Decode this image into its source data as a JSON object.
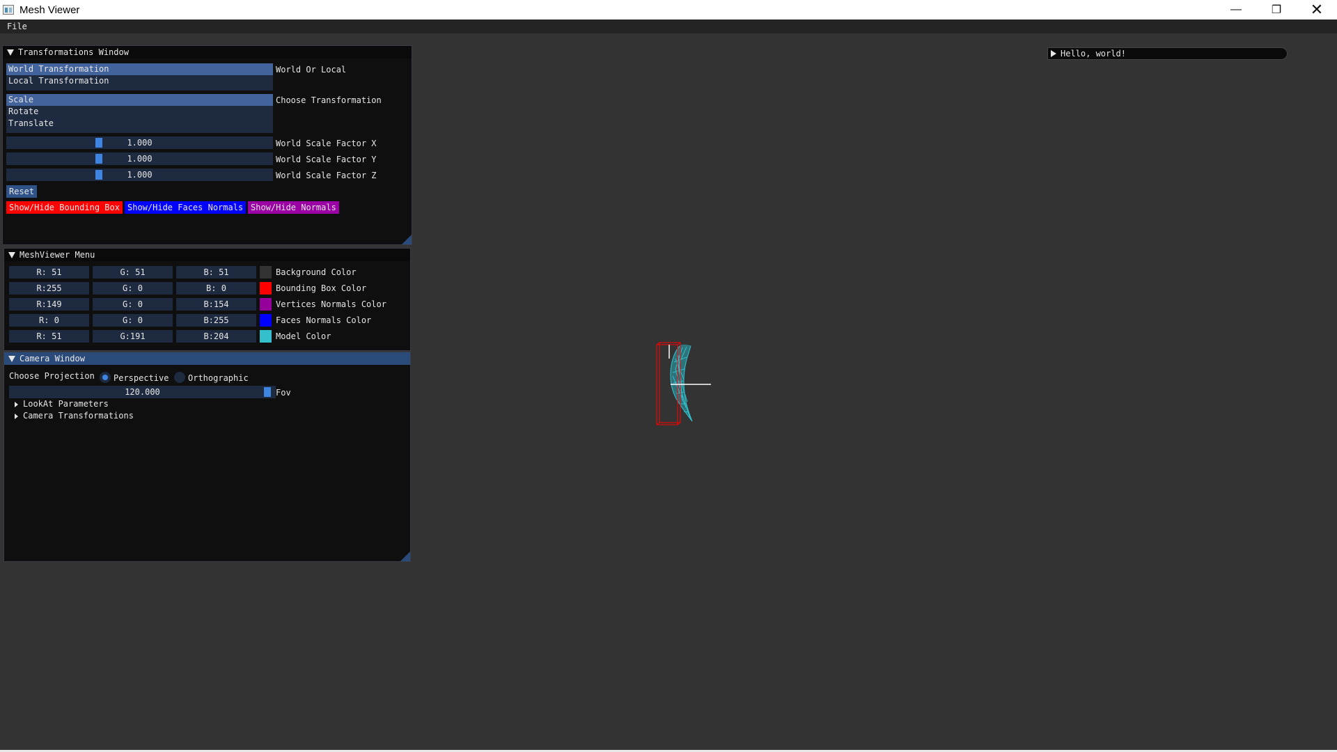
{
  "window": {
    "title": "Mesh Viewer",
    "controls": {
      "minimize": "—",
      "restore": "❐",
      "close": "✕"
    }
  },
  "menubar": {
    "items": [
      "File"
    ]
  },
  "transformations_window": {
    "title": "Transformations Window",
    "space_list": {
      "items": [
        "World Transformation",
        "Local Transformation"
      ],
      "selected": "World Transformation",
      "label": "World Or Local"
    },
    "transform_list": {
      "items": [
        "Scale",
        "Rotate",
        "Translate"
      ],
      "selected": "Scale",
      "label": "Choose Transformation"
    },
    "sliders": [
      {
        "value": "1.000",
        "label": "World Scale Factor X",
        "fraction": 0.34
      },
      {
        "value": "1.000",
        "label": "World Scale Factor Y",
        "fraction": 0.34
      },
      {
        "value": "1.000",
        "label": "World Scale Factor Z",
        "fraction": 0.34
      }
    ],
    "reset_label": "Reset",
    "toggle_buttons": {
      "bounding_box": "Show/Hide Bounding Box",
      "faces_normals": "Show/Hide Faces Normals",
      "normals": "Show/Hide Normals"
    }
  },
  "meshviewer_menu": {
    "title": "MeshViewer Menu",
    "colors": [
      {
        "r": "R: 51",
        "g": "G: 51",
        "b": "B: 51",
        "swatch": "#333333",
        "label": "Background Color"
      },
      {
        "r": "R:255",
        "g": "G:  0",
        "b": "B:  0",
        "swatch": "#ff0000",
        "label": "Bounding Box Color"
      },
      {
        "r": "R:149",
        "g": "G:  0",
        "b": "B:154",
        "swatch": "#95009a",
        "label": "Vertices Normals Color"
      },
      {
        "r": "R:  0",
        "g": "G:  0",
        "b": "B:255",
        "swatch": "#0000ff",
        "label": "Faces Normals Color"
      },
      {
        "r": "R: 51",
        "g": "G:191",
        "b": "B:204",
        "swatch": "#33bfcc",
        "label": "Model Color"
      }
    ]
  },
  "camera_window": {
    "title": "Camera Window",
    "projection_label": "Choose Projection",
    "projection_options": [
      "Perspective",
      "Orthographic"
    ],
    "projection_selected": "Perspective",
    "fov": {
      "value": "120.000",
      "label": "Fov",
      "fraction": 0.98
    },
    "tree_nodes": [
      "LookAt Parameters",
      "Camera Transformations"
    ]
  },
  "hello_window": {
    "title": "Hello, world!"
  },
  "colors": {
    "background": "#333333",
    "model": "#33bfcc",
    "bounding_box": "#ff0000",
    "accent": "#3d85e0"
  }
}
